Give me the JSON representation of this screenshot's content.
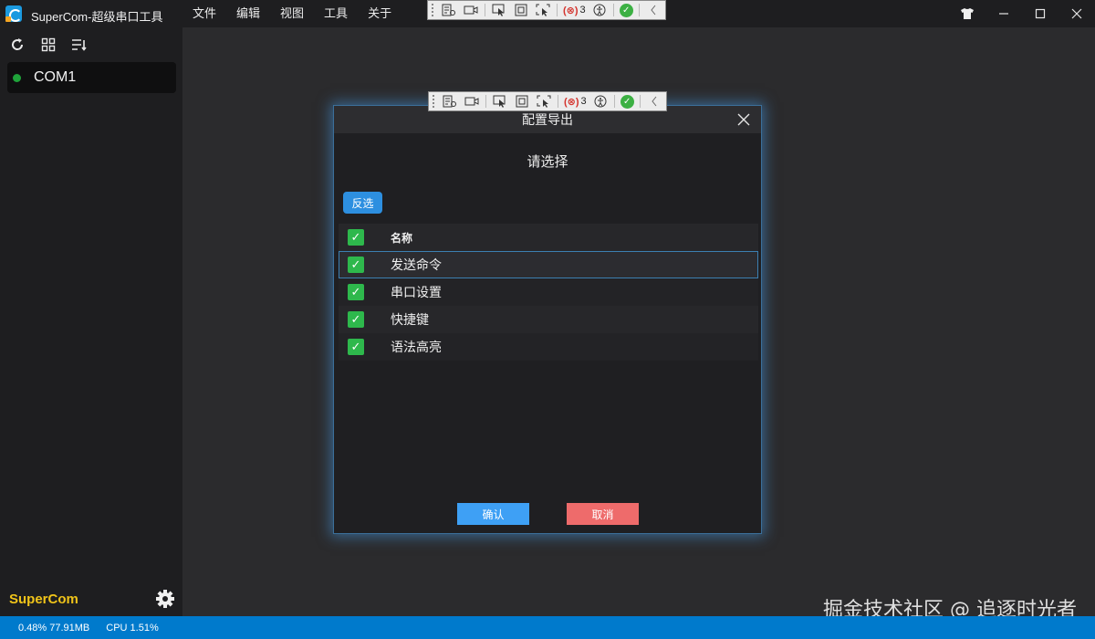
{
  "window": {
    "title": "SuperCom-超级串口工具",
    "menu": [
      "文件",
      "编辑",
      "视图",
      "工具",
      "关于"
    ]
  },
  "debug_toolbar": {
    "binding_error_count": "3"
  },
  "sidebar": {
    "port": {
      "label": "COM1",
      "status_color": "#1fa33a"
    },
    "brand": "SuperCom",
    "brand_color": "#f0c419"
  },
  "dialog": {
    "title": "配置导出",
    "subtitle": "请选择",
    "invert_label": "反选",
    "column_header": "名称",
    "items": [
      {
        "label": "发送命令",
        "checked": true
      },
      {
        "label": "串口设置",
        "checked": true
      },
      {
        "label": "快捷键",
        "checked": true
      },
      {
        "label": "语法高亮",
        "checked": true
      }
    ],
    "ok_label": "确认",
    "cancel_label": "取消"
  },
  "status_bar": {
    "memory": "0.48% 77.91MB",
    "cpu": "CPU 1.51%"
  },
  "watermark": "掘金技术社区 @ 追逐时光者",
  "colors": {
    "accent": "#007acc",
    "ok_button": "#3ea0f5",
    "cancel_button": "#ee6b6b",
    "checkbox": "#2eb84c"
  }
}
